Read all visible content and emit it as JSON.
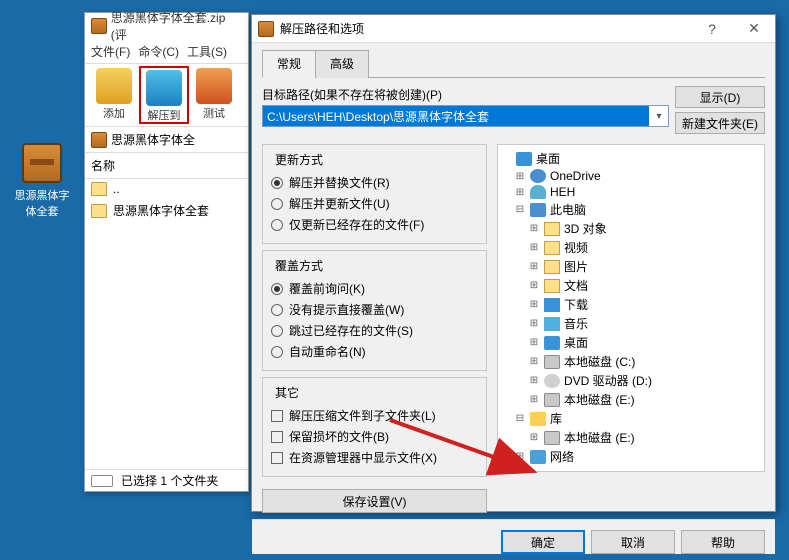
{
  "desktop_icon": {
    "label": "思源黑体字体全套"
  },
  "winrar": {
    "title": "思源黑体字体全套.zip (评",
    "menu": [
      "文件(F)",
      "命令(C)",
      "工具(S)"
    ],
    "tools": {
      "add": "添加",
      "extract": "解压到",
      "test": "测试"
    },
    "address": "思源黑体字体全",
    "list_hdr": "名称",
    "rows": [
      "..",
      "思源黑体字体全套"
    ],
    "status": "已选择 1 个文件夹"
  },
  "dialog": {
    "title": "解压路径和选项",
    "help_btn": "?",
    "tabs": {
      "general": "常规",
      "advanced": "高级"
    },
    "path_label": "目标路径(如果不存在将被创建)(P)",
    "path_value": "C:\\Users\\HEH\\Desktop\\思源黑体字体全套",
    "display_btn": "显示(D)",
    "newfolder_btn": "新建文件夹(E)",
    "groups": {
      "update": {
        "title": "更新方式",
        "opts": [
          "解压并替换文件(R)",
          "解压并更新文件(U)",
          "仅更新已经存在的文件(F)"
        ]
      },
      "overwrite": {
        "title": "覆盖方式",
        "opts": [
          "覆盖前询问(K)",
          "没有提示直接覆盖(W)",
          "跳过已经存在的文件(S)",
          "自动重命名(N)"
        ]
      },
      "other": {
        "title": "其它",
        "opts": [
          "解压压缩文件到子文件夹(L)",
          "保留损坏的文件(B)",
          "在资源管理器中显示文件(X)"
        ]
      }
    },
    "save_btn": "保存设置(V)",
    "tree": [
      {
        "ind": 0,
        "exp": "",
        "ico": "desk",
        "label": "桌面"
      },
      {
        "ind": 1,
        "exp": "⊞",
        "ico": "cloud",
        "label": "OneDrive"
      },
      {
        "ind": 1,
        "exp": "⊞",
        "ico": "user",
        "label": "HEH"
      },
      {
        "ind": 1,
        "exp": "⊟",
        "ico": "pc",
        "label": "此电脑"
      },
      {
        "ind": 2,
        "exp": "⊞",
        "ico": "fold",
        "label": "3D 对象"
      },
      {
        "ind": 2,
        "exp": "⊞",
        "ico": "fold",
        "label": "视频"
      },
      {
        "ind": 2,
        "exp": "⊞",
        "ico": "fold",
        "label": "图片"
      },
      {
        "ind": 2,
        "exp": "⊞",
        "ico": "fold",
        "label": "文档"
      },
      {
        "ind": 2,
        "exp": "⊞",
        "ico": "down",
        "label": "下载"
      },
      {
        "ind": 2,
        "exp": "⊞",
        "ico": "music",
        "label": "音乐"
      },
      {
        "ind": 2,
        "exp": "⊞",
        "ico": "desk",
        "label": "桌面"
      },
      {
        "ind": 2,
        "exp": "⊞",
        "ico": "disk",
        "label": "本地磁盘 (C:)"
      },
      {
        "ind": 2,
        "exp": "⊞",
        "ico": "dvd",
        "label": "DVD 驱动器 (D:)"
      },
      {
        "ind": 2,
        "exp": "⊞",
        "ico": "disk",
        "label": "本地磁盘 (E:)"
      },
      {
        "ind": 1,
        "exp": "⊟",
        "ico": "lib",
        "label": "库"
      },
      {
        "ind": 2,
        "exp": "⊞",
        "ico": "disk",
        "label": "本地磁盘 (E:)"
      },
      {
        "ind": 1,
        "exp": "⊞",
        "ico": "net",
        "label": "网络"
      }
    ],
    "buttons": {
      "ok": "确定",
      "cancel": "取消",
      "help": "帮助"
    }
  }
}
